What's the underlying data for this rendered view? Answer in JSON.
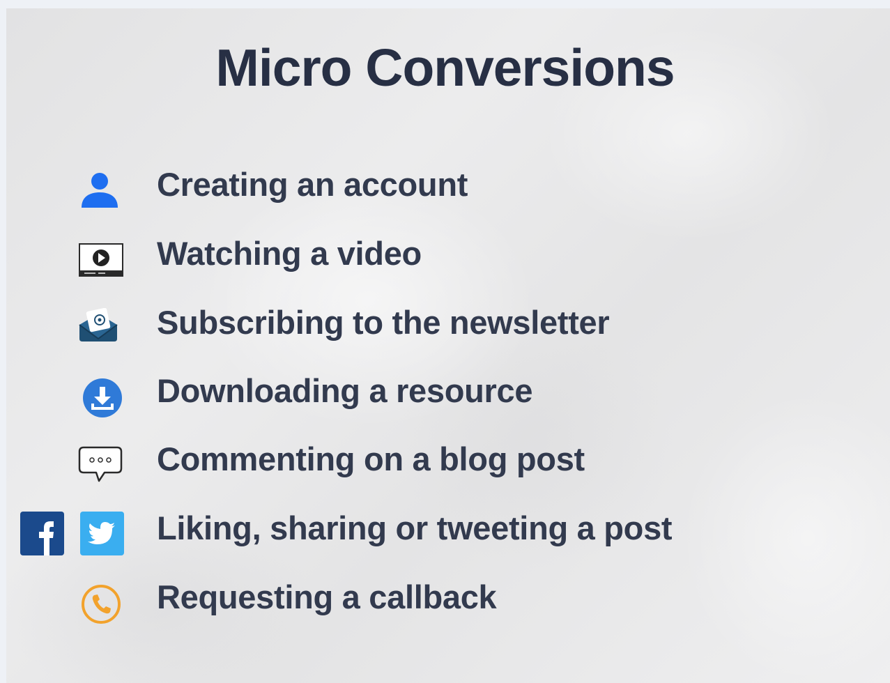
{
  "slide": {
    "title": "Micro Conversions",
    "items": [
      {
        "label": "Creating an account",
        "icon": "user-icon"
      },
      {
        "label": "Watching a video",
        "icon": "video-icon"
      },
      {
        "label": "Subscribing to the newsletter",
        "icon": "newsletter-icon"
      },
      {
        "label": "Downloading a resource",
        "icon": "download-icon"
      },
      {
        "label": "Commenting on a blog post",
        "icon": "comment-icon"
      },
      {
        "label": "Liking, sharing or tweeting a post",
        "icon": [
          "facebook-icon",
          "twitter-icon"
        ]
      },
      {
        "label": "Requesting a callback",
        "icon": "phone-icon"
      }
    ]
  },
  "colors": {
    "title": "#272f44",
    "text": "#323a4e",
    "user_blue": "#1e6ef0",
    "download_blue": "#2f7ad8",
    "facebook_blue": "#1b4a8c",
    "twitter_blue": "#3aaef0",
    "phone_orange": "#f2a22c"
  }
}
